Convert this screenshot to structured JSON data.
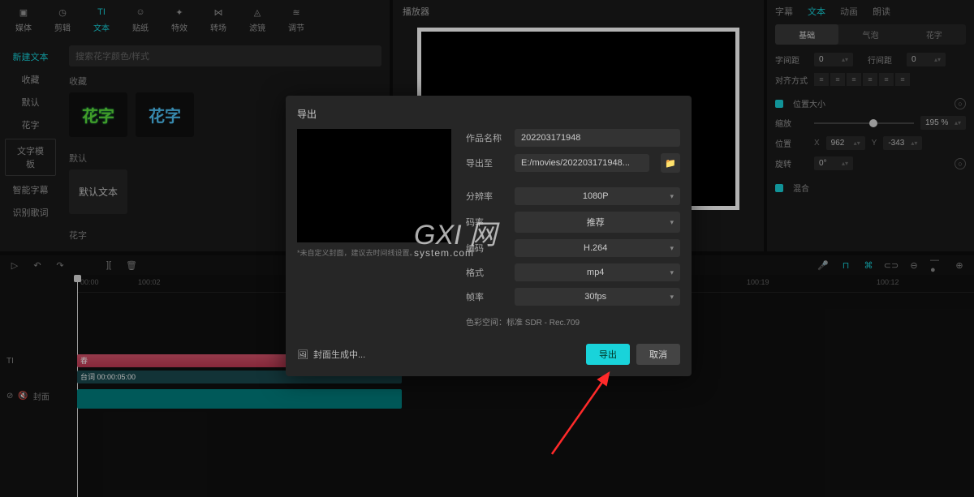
{
  "top_tabs": {
    "media": "媒体",
    "cutout": "剪辑",
    "text": "文本",
    "sticker": "贴纸",
    "effect": "特效",
    "transition": "转场",
    "filter": "滤镜",
    "adjust": "调节"
  },
  "side_nav": {
    "new_text": "新建文本",
    "favorite": "收藏",
    "default": "默认",
    "fancy": "花字",
    "template": "文字模板",
    "smart_sub": "智能字幕",
    "lyric": "识别歌词"
  },
  "asset": {
    "search_placeholder": "搜索花字颜色/样式",
    "section_fav": "收藏",
    "thumb1": "花字",
    "thumb2": "花字",
    "section_default": "默认",
    "default_text_thumb": "默认文本",
    "section_fancy": "花字"
  },
  "player_title": "播放器",
  "right_panel": {
    "tabs": {
      "subtitle": "字幕",
      "text": "文本",
      "anim": "动画",
      "read": "朗读"
    },
    "subtabs": {
      "basic": "基础",
      "bubble": "气泡",
      "fancy": "花字"
    },
    "char_spacing_label": "字间距",
    "char_spacing_val": "0",
    "line_spacing_label": "行间距",
    "line_spacing_val": "0",
    "align_label": "对齐方式",
    "pos_size_label": "位置大小",
    "scale_label": "缩放",
    "scale_val": "195 %",
    "position_label": "位置",
    "pos_x_label": "X",
    "pos_x": "962",
    "pos_y_label": "Y",
    "pos_y": "-343",
    "rotate_label": "旋转",
    "rotate_val": "0°",
    "mix_label": "混合"
  },
  "timeline": {
    "ticks": {
      "t0": "00:00",
      "t1": "100:02",
      "t2": "100:19",
      "t3": "100:12"
    },
    "text_clip": "春",
    "audio_clip": "台词  00:00:05:00",
    "cover_label": "封面",
    "track_tt": "TI"
  },
  "export_dialog": {
    "title": "导出",
    "note": "*未自定义封面，建议去时间线设置。",
    "name_label": "作品名称",
    "name_val": "202203171948",
    "dest_label": "导出至",
    "dest_val": "E:/movies/202203171948...",
    "res_label": "分辨率",
    "res_val": "1080P",
    "bitrate_label": "码率",
    "bitrate_val": "推荐",
    "codec_label": "编码",
    "codec_val": "H.264",
    "format_label": "格式",
    "format_val": "mp4",
    "fps_label": "帧率",
    "fps_val": "30fps",
    "color_space": "色彩空间：标准 SDR - Rec.709",
    "cover_gen": "封面生成中...",
    "export_btn": "导出",
    "cancel_btn": "取消"
  },
  "watermark": {
    "big": "GXI 网",
    "small": "system.com"
  }
}
